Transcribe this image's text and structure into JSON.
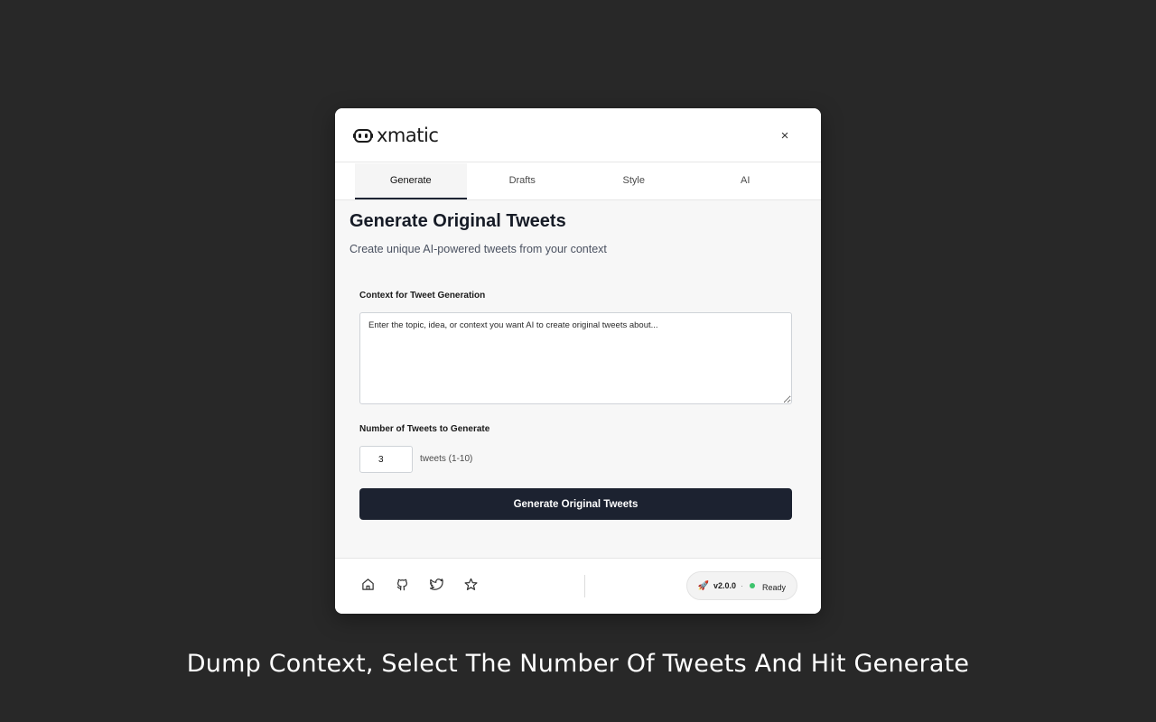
{
  "app": {
    "logo_text": "xmatic",
    "close_label": "×"
  },
  "tabs": [
    {
      "label": "Generate",
      "active": true
    },
    {
      "label": "Drafts",
      "active": false
    },
    {
      "label": "Style",
      "active": false
    },
    {
      "label": "AI",
      "active": false
    }
  ],
  "main": {
    "title": "Generate Original Tweets",
    "subtitle": "Create unique AI-powered tweets from your context",
    "context_label": "Context for Tweet Generation",
    "context_placeholder": "Enter the topic, idea, or context you want AI to create original tweets about...",
    "context_value": "",
    "count_label": "Number of Tweets to Generate",
    "count_value": "3",
    "count_hint": "tweets (1-10)",
    "generate_button": "Generate Original Tweets"
  },
  "footer": {
    "icons": [
      "home-icon",
      "github-icon",
      "twitter-icon",
      "star-icon"
    ],
    "rocket": "🚀",
    "version": "v2.0.0",
    "separator": "·",
    "status": "Ready",
    "status_color": "#3ec46d"
  },
  "caption": "Dump Context, Select The Number Of Tweets And Hit Generate",
  "colors": {
    "background": "#282828",
    "primary_button": "#1c2230",
    "accent_tab_underline": "#1e2433"
  }
}
